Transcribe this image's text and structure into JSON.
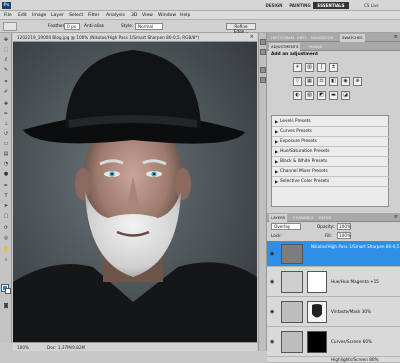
{
  "app": {
    "logo": "Ps",
    "workspaces": [
      "ESSENTIALS",
      "DESIGN",
      "PAINTING"
    ],
    "cs_live": "CS Live",
    "window_controls": [
      "–",
      "□",
      "✕"
    ]
  },
  "menu": [
    "File",
    "Edit",
    "Image",
    "Layer",
    "Select",
    "Filter",
    "Analysis",
    "3D",
    "View",
    "Window",
    "Help"
  ],
  "options": {
    "feather_label": "Feather:",
    "feather_value": "0 px",
    "antialias_label": "Anti-alias",
    "style_label": "Style:",
    "style_value": "Normal",
    "refine_edge": "Refine Edge..."
  },
  "document": {
    "tab_title": "1202219_19004 Blog.jpg @ 100% (Nikolas/High Pass 1/Smart Sharpen 80-0,5, RGB/8*)",
    "close": "×",
    "zoom": "100%",
    "doc_size": "Doc: 1,37M/9,82M"
  },
  "panels": {
    "top_tabs": [
      "HISTOGRAM",
      "INFO",
      "NAVIGATOR",
      "SWATCHES"
    ],
    "adj_tabs": [
      "ADJUSTMENTS",
      "MASKS"
    ],
    "adj_heading": "Add an adjustment",
    "presets": [
      "Levels Presets",
      "Curves Presets",
      "Exposure Presets",
      "Hue/Saturation Presets",
      "Black & White Presets",
      "Channel Mixer Presets",
      "Selective Color Presets"
    ]
  },
  "layers": {
    "tabs": [
      "LAYERS",
      "CHANNELS",
      "PATHS"
    ],
    "blend_mode": "Overlay",
    "opacity_label": "Opacity:",
    "opacity_value": "100%",
    "lock_label": "Lock:",
    "fill_label": "Fill:",
    "fill_value": "100%",
    "items": [
      {
        "name": "Nikolas/High Pass 1/Smart Sharpen 80-0,5",
        "selected": true
      },
      {
        "name": "Hue/Hue Magenta +15",
        "selected": false
      },
      {
        "name": "Vintaste/Mask 30%",
        "selected": false
      },
      {
        "name": "Curves/Screen 60%",
        "selected": false
      },
      {
        "name": "Highlights/Screen 80%",
        "selected": false
      }
    ]
  },
  "colors": {
    "foreground": "#1a8be6",
    "background": "#ffffff",
    "selection": "#2f8fe6"
  }
}
